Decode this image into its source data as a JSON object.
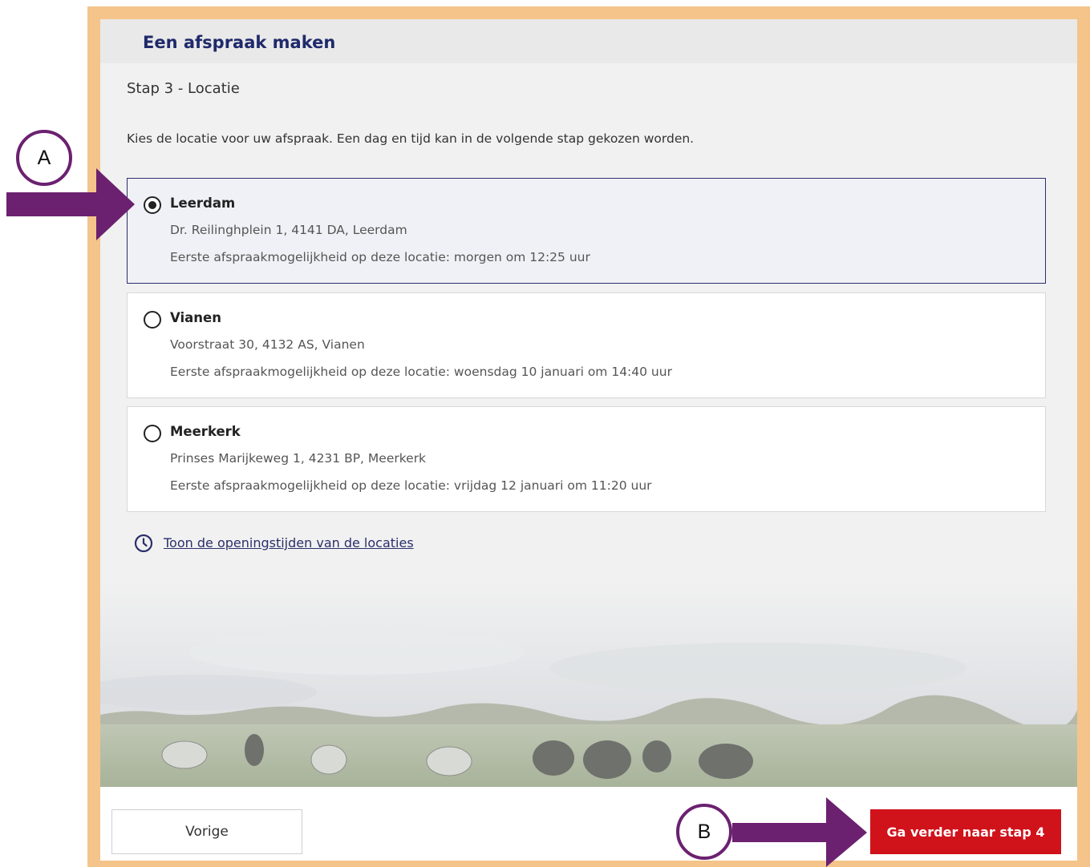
{
  "page": {
    "title": "Een afspraak maken",
    "step": "Stap 3 - Locatie",
    "intro": "Kies de locatie voor uw afspraak. Een dag en tijd kan in de volgende stap gekozen worden."
  },
  "locations": [
    {
      "name": "Leerdam",
      "address": "Dr. Reilinghplein 1, 4141 DA, Leerdam",
      "first": "Eerste afspraakmogelijkheid op deze locatie: morgen om 12:25 uur",
      "selected": true
    },
    {
      "name": "Vianen",
      "address": "Voorstraat 30, 4132 AS, Vianen",
      "first": "Eerste afspraakmogelijkheid op deze locatie: woensdag 10 januari om 14:40 uur",
      "selected": false
    },
    {
      "name": "Meerkerk",
      "address": "Prinses Marijkeweg 1, 4231 BP, Meerkerk",
      "first": "Eerste afspraakmogelijkheid op deze locatie: vrijdag 12 januari om 11:20 uur",
      "selected": false
    }
  ],
  "hours_link": {
    "label": "Toon de openingstijden van de locaties",
    "icon": "clock-icon"
  },
  "footer": {
    "prev_label": "Vorige",
    "next_label": "Ga verder naar stap 4"
  },
  "callouts": {
    "a": "A",
    "b": "B"
  },
  "colors": {
    "frame": "#f5c48a",
    "title": "#1f2a6b",
    "primary_button": "#d0121b",
    "callout": "#6b2170"
  }
}
